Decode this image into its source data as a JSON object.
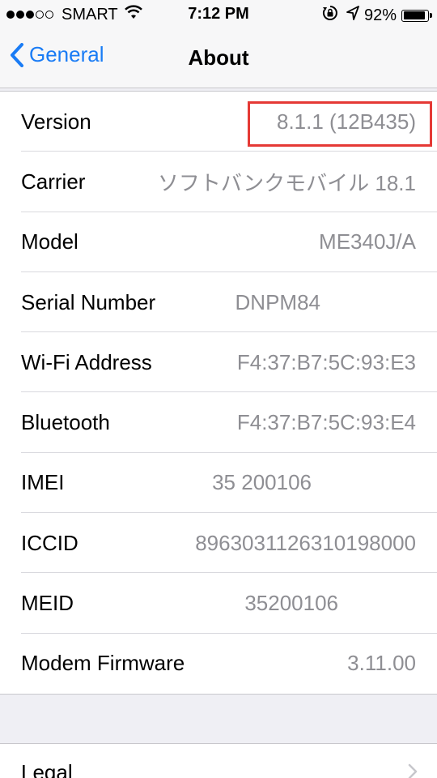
{
  "status_bar": {
    "carrier": "SMART",
    "signal_dots_filled": 3,
    "signal_dots_total": 5,
    "time": "7:12 PM",
    "battery_percent": "92%",
    "battery_level": 0.92,
    "icons": [
      "wifi-icon",
      "orientation-lock-icon",
      "location-arrow-icon",
      "battery-icon"
    ]
  },
  "nav": {
    "back_label": "General",
    "title": "About",
    "back_icon": "chevron-left-icon"
  },
  "rows": [
    {
      "label": "Version",
      "value": "8.1.1 (12B435)",
      "highlighted": true
    },
    {
      "label": "Carrier",
      "value": "ソフトバンクモバイル 18.1"
    },
    {
      "label": "Model",
      "value": "ME340J/A"
    },
    {
      "label": "Serial Number",
      "value": "DNPM84"
    },
    {
      "label": "Wi-Fi Address",
      "value": "F4:37:B7:5C:93:E3"
    },
    {
      "label": "Bluetooth",
      "value": "F4:37:B7:5C:93:E4"
    },
    {
      "label": "IMEI",
      "value": "35 200106"
    },
    {
      "label": "ICCID",
      "value": "8963031126310198000"
    },
    {
      "label": "MEID",
      "value": "35200106"
    },
    {
      "label": "Modem Firmware",
      "value": "3.11.00"
    }
  ],
  "legal": {
    "label": "Legal",
    "icon": "chevron-right-icon"
  },
  "colors": {
    "accent": "#1a7cf5",
    "highlight": "#e53935",
    "value_text": "#8e8e93",
    "background": "#efeff4"
  }
}
